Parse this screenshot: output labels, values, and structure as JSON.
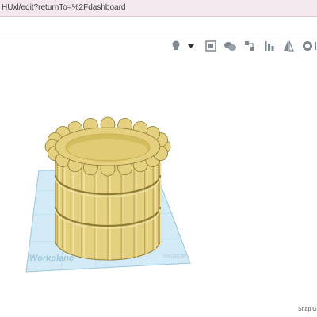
{
  "browser": {
    "url": "HUxl/edit?returnTo=%2Fdashboard"
  },
  "toolbar": {
    "icons": [
      "lightbulb-icon",
      "dropdown-arrow-icon",
      "group-icon",
      "ungroup-icon",
      "align-icon",
      "flip-icon",
      "mirror-icon",
      "cruise-icon",
      "overflow-icon"
    ]
  },
  "workplane": {
    "label": "Workplane",
    "watermark": "TINKERCAD",
    "color": "#cfe8f5"
  },
  "scene": {
    "object": "scalloped-cylinder-pot",
    "color": "#e8d887"
  },
  "status": {
    "snap_label": "Snap G"
  }
}
